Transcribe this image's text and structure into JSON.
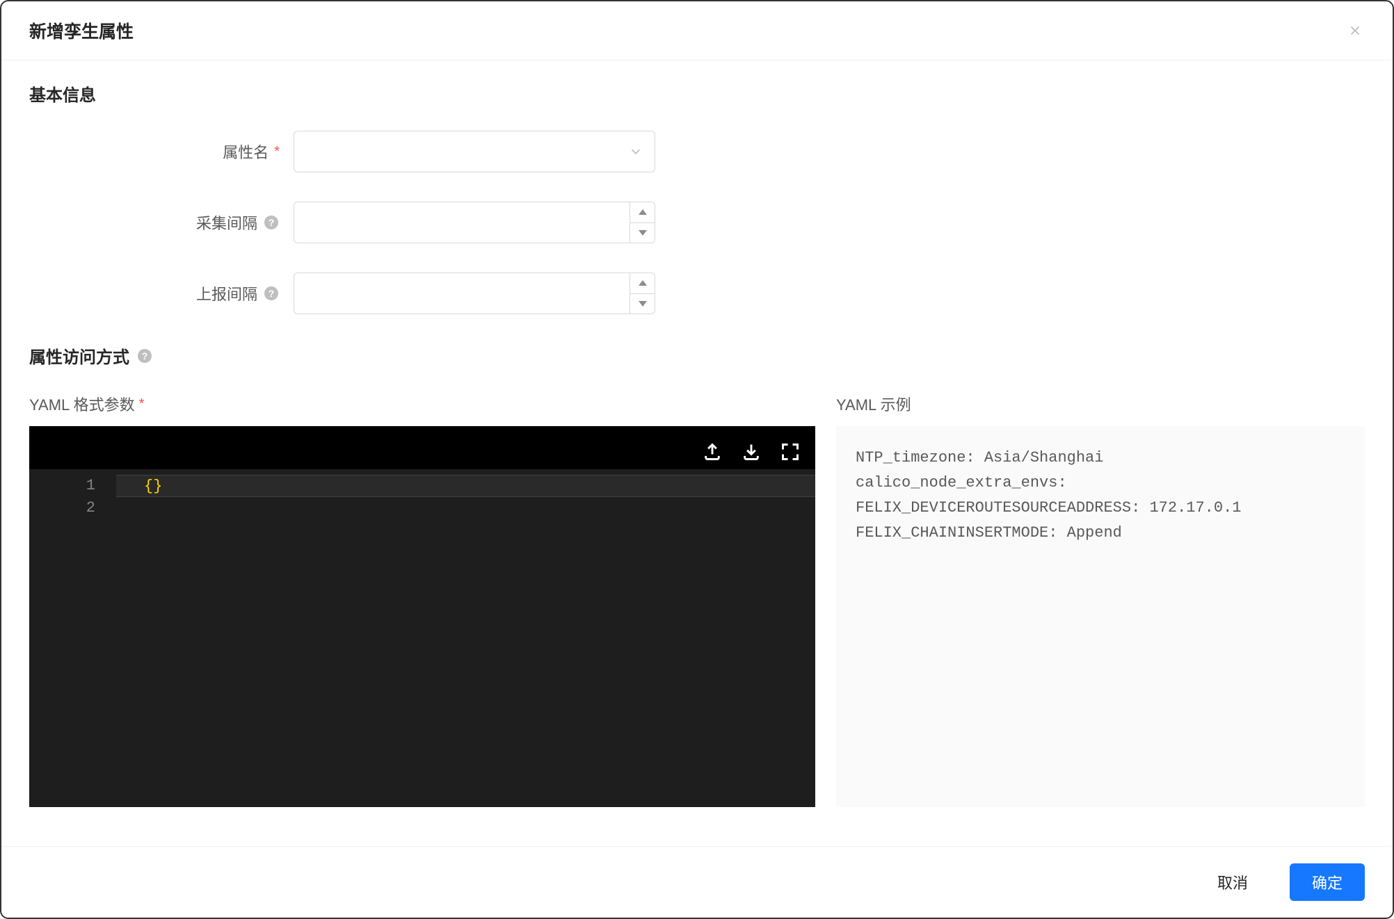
{
  "modal": {
    "title": "新增孪生属性"
  },
  "sections": {
    "basic_info_title": "基本信息",
    "access_method_title": "属性访问方式"
  },
  "form": {
    "property_name": {
      "label": "属性名",
      "value": ""
    },
    "collect_interval": {
      "label": "采集间隔",
      "value": ""
    },
    "report_interval": {
      "label": "上报间隔",
      "value": ""
    }
  },
  "yaml": {
    "params_label": "YAML 格式参数",
    "example_label": "YAML 示例",
    "editor_lines": [
      "1",
      "2"
    ],
    "editor_content": "{}",
    "example_content": "NTP_timezone: Asia/Shanghai\ncalico_node_extra_envs:\nFELIX_DEVICEROUTESOURCEADDRESS: 172.17.0.1\nFELIX_CHAININSERTMODE: Append"
  },
  "footer": {
    "cancel_label": "取消",
    "confirm_label": "确定"
  }
}
